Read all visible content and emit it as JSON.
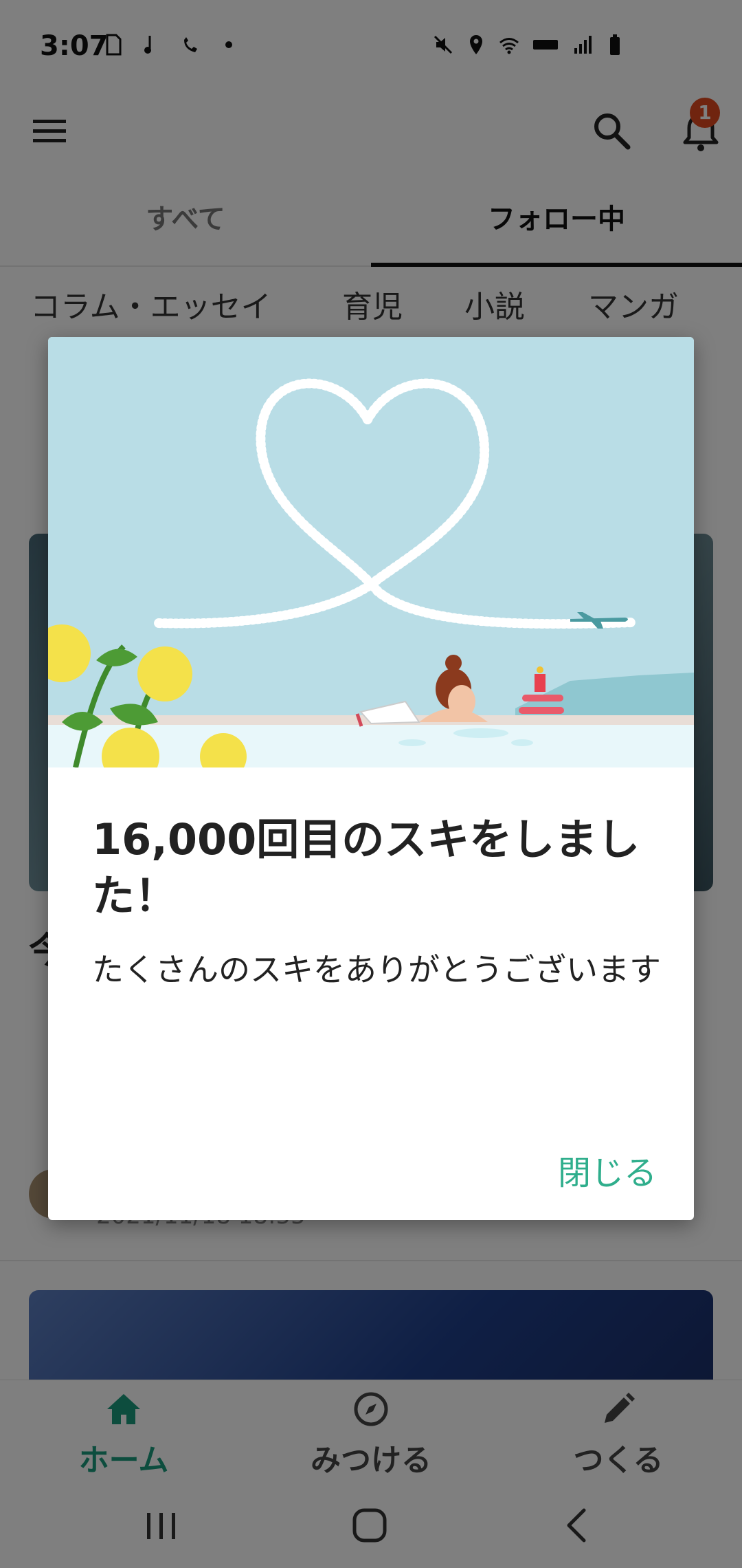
{
  "status_bar": {
    "time": "3:07"
  },
  "header": {
    "notification_count": "1"
  },
  "tabs": [
    {
      "label": "すべて"
    },
    {
      "label": "フォロー中"
    }
  ],
  "categories": [
    "コラム・エッセイ",
    "育児",
    "小説",
    "マンガ"
  ],
  "feed": {
    "title_fragment": "今",
    "date": "2021/11/18 18:55"
  },
  "bottom_nav": [
    {
      "label": "ホーム",
      "icon": "home-icon"
    },
    {
      "label": "みつける",
      "icon": "compass-icon"
    },
    {
      "label": "つくる",
      "icon": "pencil-icon"
    }
  ],
  "dialog": {
    "title": "16,000回目のスキをしました！",
    "message": "たくさんのスキをありがとうございます",
    "close_label": "閉じる"
  },
  "colors": {
    "accent": "#2fae8c",
    "nav_active": "#1a9a7c",
    "badge": "#e0491e",
    "sky": "#b9dde6"
  }
}
